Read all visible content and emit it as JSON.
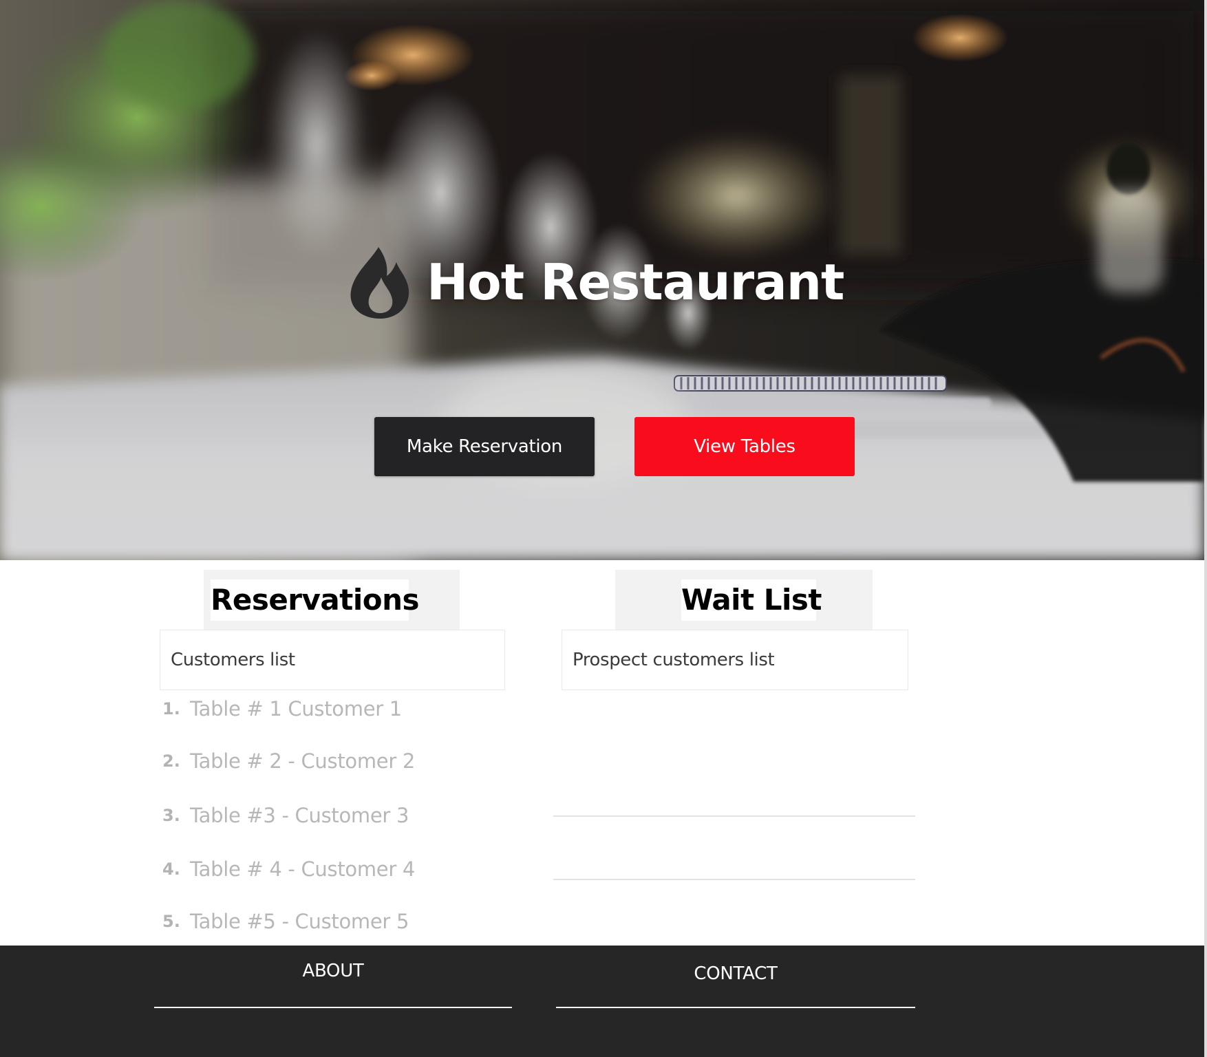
{
  "hero": {
    "brand_name": "Hot Restaurant",
    "icon": "flame-icon",
    "buttons": {
      "make_reservation": "Make Reservation",
      "view_tables": "View Tables"
    }
  },
  "reservations": {
    "heading": "Reservations",
    "subheading": "Customers list",
    "items": [
      {
        "number": "1.",
        "text": "Table # 1 Customer 1"
      },
      {
        "number": "2.",
        "text": "Table # 2 - Customer 2"
      },
      {
        "number": "3.",
        "text": "Table #3 - Customer 3"
      },
      {
        "number": "4.",
        "text": "Table # 4 - Customer 4"
      },
      {
        "number": "5.",
        "text": "Table #5 - Customer 5"
      }
    ]
  },
  "wait_list": {
    "heading": "Wait List",
    "subheading": "Prospect customers list"
  },
  "footer": {
    "about": "ABOUT",
    "contact": "CONTACT"
  },
  "colors": {
    "dark_button": "#232325",
    "accent_red": "#f90c1c",
    "footer_background": "#262626"
  }
}
